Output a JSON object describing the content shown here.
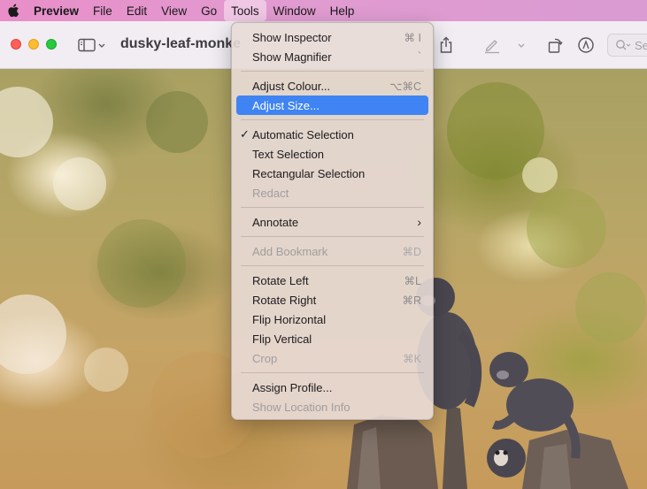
{
  "menubar": {
    "apple_icon": "apple-logo-icon",
    "app_name": "Preview",
    "items": [
      "File",
      "Edit",
      "View",
      "Go",
      "Tools",
      "Window",
      "Help"
    ]
  },
  "window": {
    "doc_title": "dusky-leaf-monke",
    "search_placeholder": "Se"
  },
  "tools_menu": {
    "show_inspector": {
      "label": "Show Inspector",
      "shortcut": "⌘ I"
    },
    "show_magnifier": {
      "label": "Show Magnifier",
      "shortcut": "`"
    },
    "adjust_colour": {
      "label": "Adjust Colour...",
      "shortcut": "⌥⌘C"
    },
    "adjust_size": {
      "label": "Adjust Size..."
    },
    "automatic_selection": {
      "label": "Automatic Selection",
      "check": "✓"
    },
    "text_selection": {
      "label": "Text Selection"
    },
    "rectangular_selection": {
      "label": "Rectangular Selection"
    },
    "redact": {
      "label": "Redact"
    },
    "annotate": {
      "label": "Annotate",
      "submenu": "›"
    },
    "add_bookmark": {
      "label": "Add Bookmark",
      "shortcut": "⌘D"
    },
    "rotate_left": {
      "label": "Rotate Left",
      "shortcut": "⌘L"
    },
    "rotate_right": {
      "label": "Rotate Right",
      "shortcut": "⌘R"
    },
    "flip_horizontal": {
      "label": "Flip Horizontal"
    },
    "flip_vertical": {
      "label": "Flip Vertical"
    },
    "crop": {
      "label": "Crop",
      "shortcut": "⌘K"
    },
    "assign_profile": {
      "label": "Assign Profile..."
    },
    "show_location_info": {
      "label": "Show Location Info"
    }
  },
  "colors": {
    "menubar_gradient_start": "#e98ec9",
    "menu_highlight": "#3f84f2"
  }
}
